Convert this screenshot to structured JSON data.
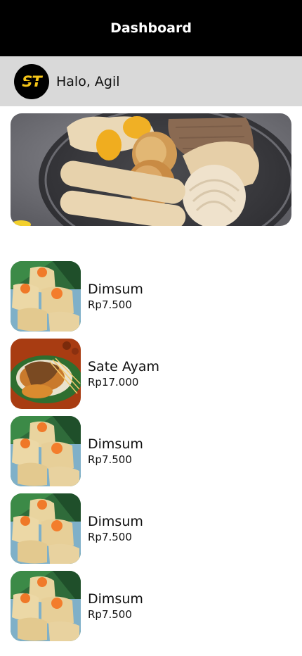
{
  "header": {
    "title": "Dashboard"
  },
  "greeting": {
    "logo_text": "ST",
    "text": "Halo, Agil"
  },
  "banner": {
    "image": "siomay-platter-image"
  },
  "menu": [
    {
      "name": "Dimsum",
      "price": "Rp7.500",
      "image": "dimsum-image"
    },
    {
      "name": "Sate Ayam",
      "price": "Rp17.000",
      "image": "sate-ayam-image"
    },
    {
      "name": "Dimsum",
      "price": "Rp7.500",
      "image": "dimsum-image"
    },
    {
      "name": "Dimsum",
      "price": "Rp7.500",
      "image": "dimsum-image"
    },
    {
      "name": "Dimsum",
      "price": "Rp7.500",
      "image": "dimsum-image"
    }
  ]
}
